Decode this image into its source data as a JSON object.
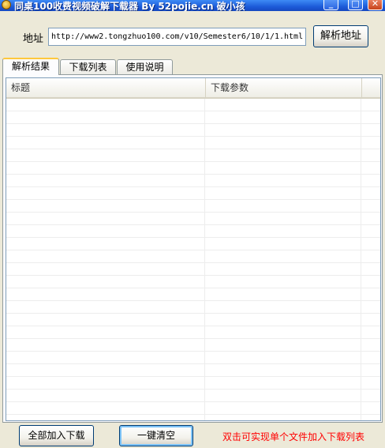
{
  "window": {
    "title": "同桌100收费视频破解下载器 By 52pojie.cn 破小孩",
    "minimize_glyph": "_",
    "maximize_glyph": "□",
    "close_glyph": "✕"
  },
  "address": {
    "label": "地址",
    "value": "http://www2.tongzhuo100.com/v10/Semester6/10/1/1.html",
    "parse_button": "解析地址"
  },
  "tabs": [
    {
      "label": "解析结果",
      "active": true
    },
    {
      "label": "下载列表",
      "active": false
    },
    {
      "label": "使用说明",
      "active": false
    }
  ],
  "list": {
    "columns": [
      "标题",
      "下载参数",
      ""
    ],
    "rows": []
  },
  "footer": {
    "add_all_button": "全部加入下载",
    "clear_button": "一键清空",
    "hint": "双击可实现单个文件加入下载列表",
    "hint_color": "#FF0000"
  }
}
